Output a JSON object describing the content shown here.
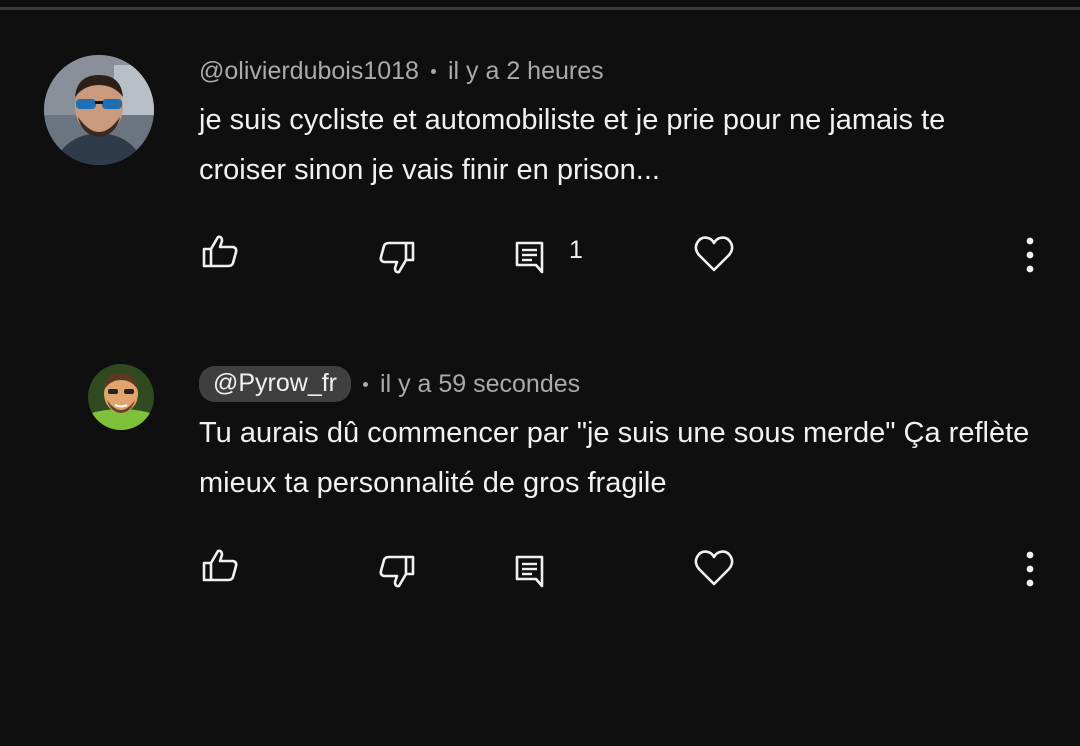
{
  "comments": [
    {
      "handle": "@olivierdubois1018",
      "time": "il y a 2 heures",
      "text": "je suis cycliste et automobiliste et je prie pour ne jamais te croiser sinon je vais finir en prison...",
      "reply_count": "1"
    },
    {
      "handle": "@Pyrow_fr",
      "time": "il y a 59 secondes",
      "text": "Tu aurais dû commencer par \"je suis une sous merde\" Ça reflète mieux ta personnalité de gros fragile",
      "reply_count": ""
    }
  ],
  "icons": {
    "like": "thumb-up-icon",
    "dislike": "thumb-down-icon",
    "reply": "comment-icon",
    "heart": "heart-icon",
    "more": "more-vert-icon"
  },
  "colors": {
    "background": "#0f0f0f",
    "text": "#f1f1f1",
    "secondary_text": "#aaaaaa",
    "handle_pill": "#3f3f3f"
  }
}
